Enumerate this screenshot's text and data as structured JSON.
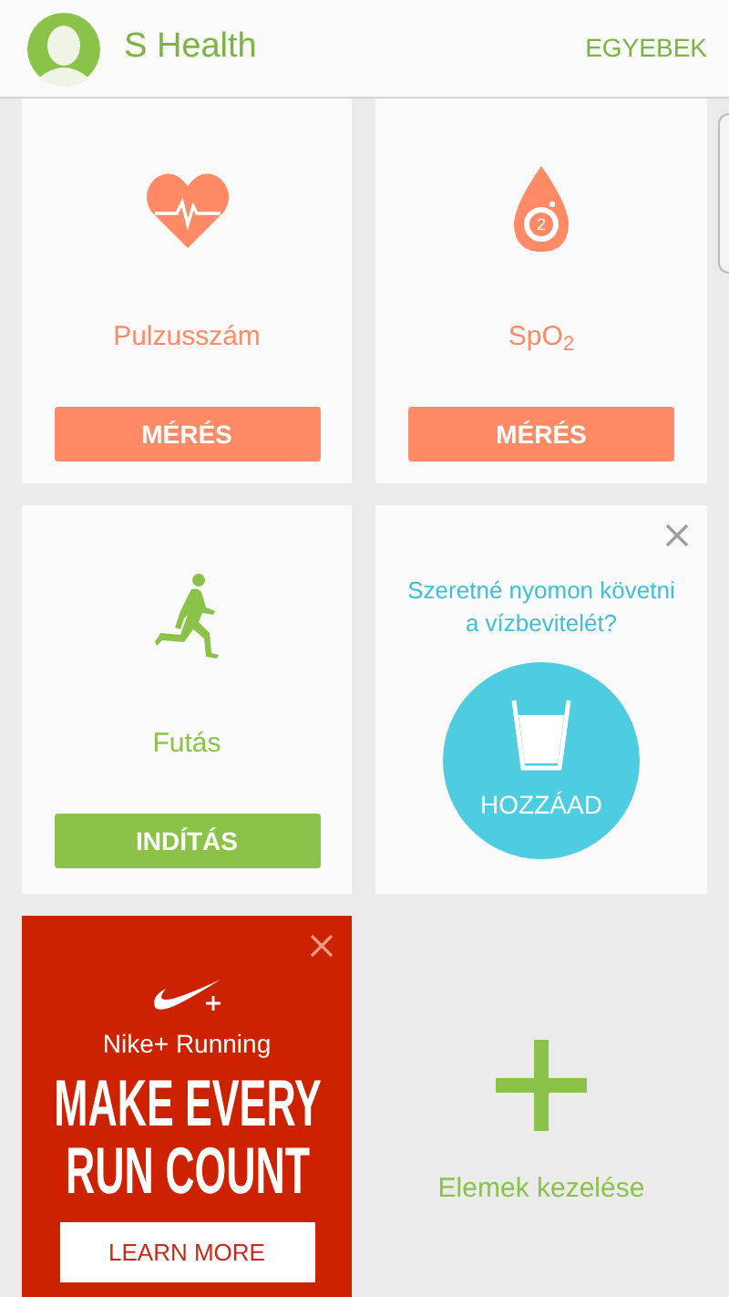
{
  "header": {
    "title": "S Health",
    "menu": "EGYEBEK"
  },
  "cards": [
    {
      "kind": "pulse",
      "label": "Pulzusszám",
      "button": "MÉRÉS",
      "color": "#ff8a65"
    },
    {
      "kind": "spo2",
      "icon_mark": "2",
      "label": "SpO$_{2}$",
      "button": "MÉRÉS",
      "color": "#ff8a65"
    },
    {
      "kind": "run",
      "label": "Futás",
      "button": "INDÍTÁS",
      "color": "#8bc34a"
    },
    {
      "kind": "water",
      "prompt": "Szeretné nyomon követni a vízbevitelét?",
      "button": "HOZZÁAD",
      "color": "#4ecde0"
    },
    {
      "kind": "ad",
      "brand": "Nike+ Running",
      "headline": "MAKE EVERY RUN COUNT",
      "button": "LEARN MORE",
      "color": "#cc2200"
    },
    {
      "kind": "manage",
      "label": "Elemek kezelése",
      "color": "#8bc34a"
    }
  ]
}
